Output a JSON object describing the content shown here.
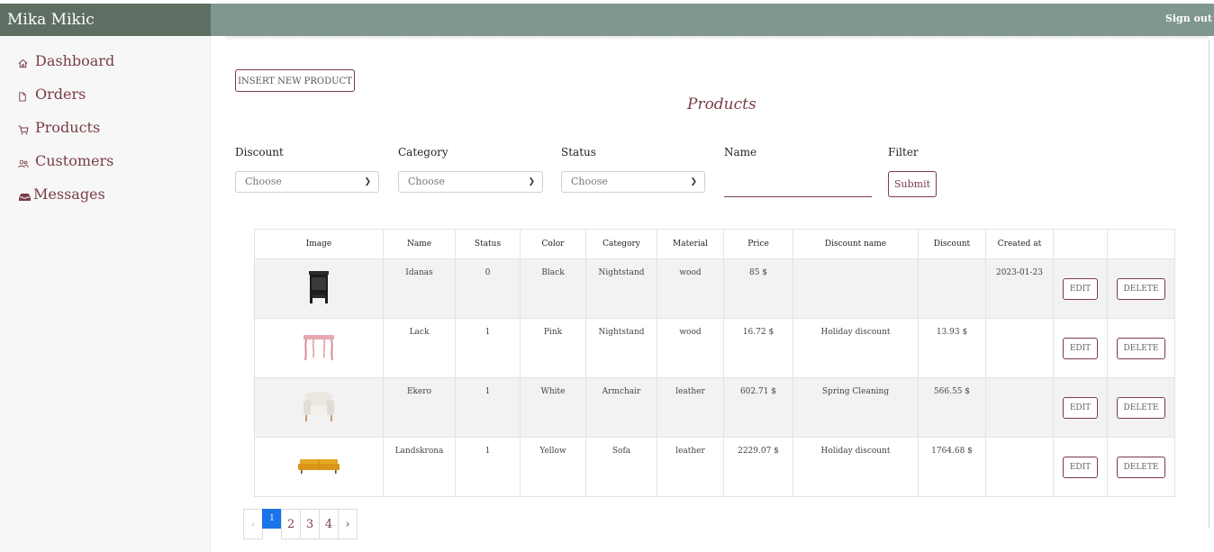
{
  "app": {
    "user_name": "Mika Mikic",
    "sign_out": "Sign out"
  },
  "sidebar": {
    "items": [
      {
        "label": "Dashboard",
        "icon": "home-icon"
      },
      {
        "label": "Orders",
        "icon": "file-icon"
      },
      {
        "label": "Products",
        "icon": "cart-icon"
      },
      {
        "label": "Customers",
        "icon": "people-icon"
      },
      {
        "label": "Messages",
        "icon": "inbox-icon"
      }
    ]
  },
  "page": {
    "insert_button": "INSERT NEW PRODUCT",
    "title": "Products"
  },
  "filters": {
    "discount": {
      "label": "Discount",
      "value": "Choose"
    },
    "category": {
      "label": "Category",
      "value": "Choose"
    },
    "status": {
      "label": "Status",
      "value": "Choose"
    },
    "name": {
      "label": "Name",
      "value": ""
    },
    "filter": {
      "label": "Filter",
      "submit": "Submit"
    }
  },
  "table": {
    "headers": [
      "Image",
      "Name",
      "Status",
      "Color",
      "Category",
      "Material",
      "Price",
      "Discount name",
      "Discount",
      "Created at",
      "",
      ""
    ],
    "edit_label": "EDIT",
    "delete_label": "DELETE",
    "rows": [
      {
        "image": "black-nightstand-image",
        "name": "Idanas",
        "status": "0",
        "color": "Black",
        "category": "Nightstand",
        "material": "wood",
        "price": "85 $",
        "discount_name": "",
        "discount": "",
        "created_at": "2023-01-23"
      },
      {
        "image": "pink-table-image",
        "name": "Lack",
        "status": "1",
        "color": "Pink",
        "category": "Nightstand",
        "material": "wood",
        "price": "16.72 $",
        "discount_name": "Holiday discount",
        "discount": "13.93 $",
        "created_at": ""
      },
      {
        "image": "white-armchair-image",
        "name": "Ekero",
        "status": "1",
        "color": "White",
        "category": "Armchair",
        "material": "leather",
        "price": "602.71 $",
        "discount_name": "Spring Cleaning",
        "discount": "566.55 $",
        "created_at": ""
      },
      {
        "image": "yellow-sofa-image",
        "name": "Landskrona",
        "status": "1",
        "color": "Yellow",
        "category": "Sofa",
        "material": "leather",
        "price": "2229.07 $",
        "discount_name": "Holiday discount",
        "discount": "1764.68 $",
        "created_at": ""
      }
    ]
  },
  "pagination": {
    "prev": "‹",
    "pages": [
      "1",
      "2",
      "3",
      "4"
    ],
    "next": "›",
    "current": "1"
  },
  "colors": {
    "brand_dark": "#5e6e63",
    "topbar": "#7f978e",
    "accent": "#7a3d45",
    "active_page": "#1a73e8"
  }
}
